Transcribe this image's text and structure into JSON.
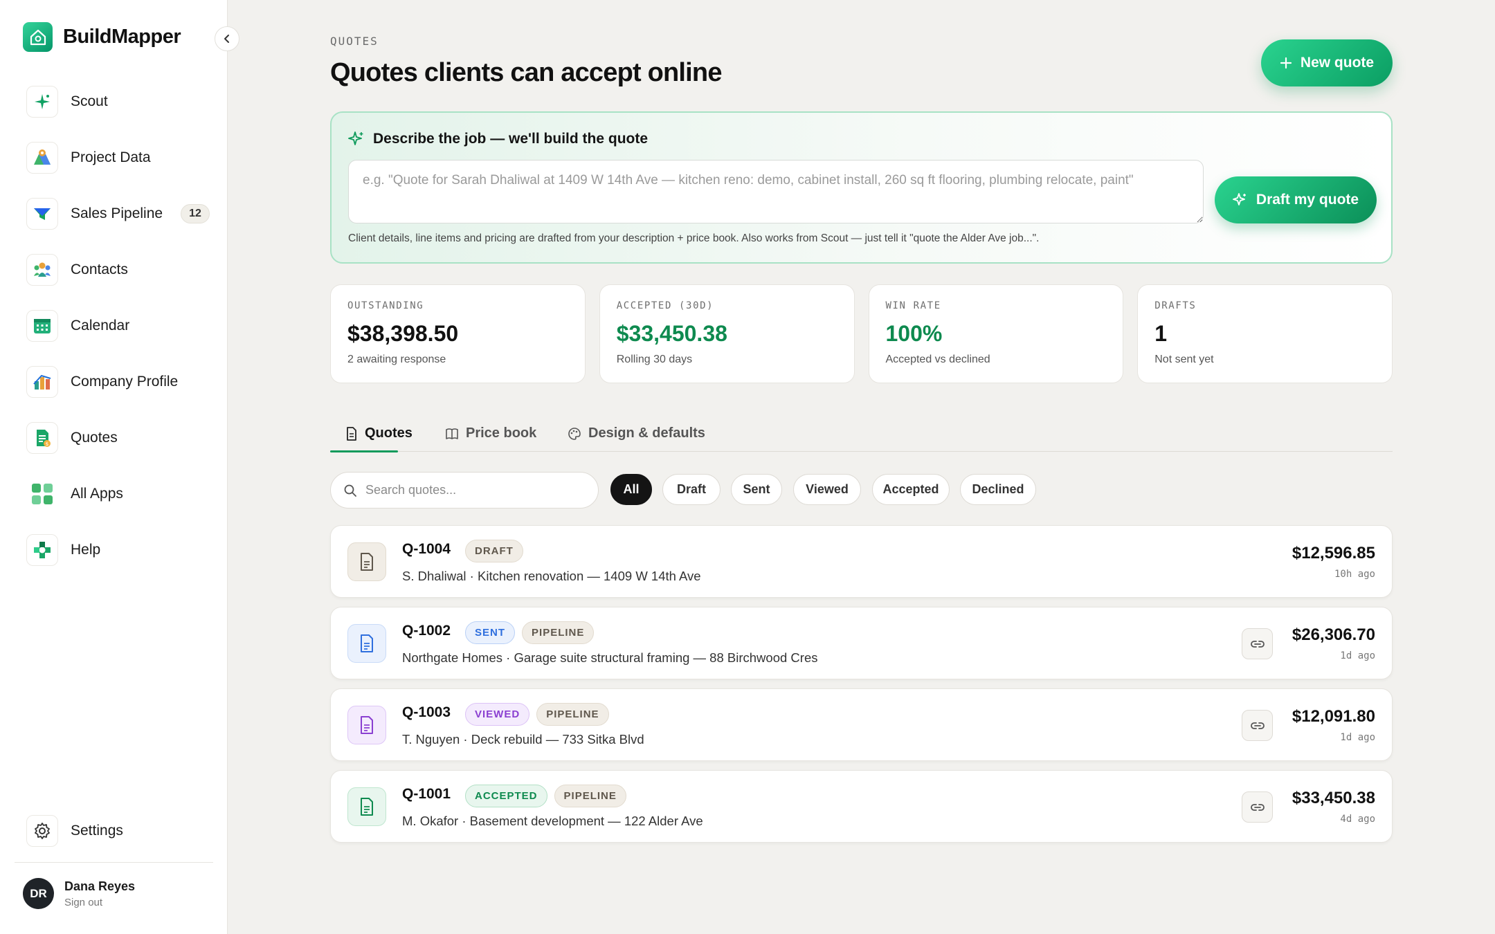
{
  "app": {
    "name": "BuildMapper"
  },
  "sidebar": {
    "items": [
      {
        "label": "Scout",
        "icon": "sparkle-icon"
      },
      {
        "label": "Project Data",
        "icon": "map-icon"
      },
      {
        "label": "Sales Pipeline",
        "icon": "funnel-icon",
        "badge": "12"
      },
      {
        "label": "Contacts",
        "icon": "people-icon"
      },
      {
        "label": "Calendar",
        "icon": "calendar-icon"
      },
      {
        "label": "Company Profile",
        "icon": "chart-icon"
      },
      {
        "label": "Quotes",
        "icon": "quote-doc-icon"
      },
      {
        "label": "All Apps",
        "icon": "grid-icon"
      },
      {
        "label": "Help",
        "icon": "help-icon"
      }
    ],
    "settings_label": "Settings",
    "user": {
      "initials": "DR",
      "name": "Dana Reyes",
      "action": "Sign out"
    }
  },
  "header": {
    "eyebrow": "QUOTES",
    "title": "Quotes clients can accept online",
    "new_quote_label": "New quote"
  },
  "ai_panel": {
    "heading": "Describe the job — we'll build the quote",
    "placeholder": "e.g. \"Quote for Sarah Dhaliwal at 1409 W 14th Ave — kitchen reno: demo, cabinet install, 260 sq ft flooring, plumbing relocate, paint\"",
    "button_label": "Draft my quote",
    "note": "Client details, line items and pricing are drafted from your description + price book. Also works from Scout — just tell it \"quote the Alder Ave job...\"."
  },
  "stats": [
    {
      "label": "OUTSTANDING",
      "value": "$38,398.50",
      "sub": "2 awaiting response"
    },
    {
      "label": "ACCEPTED (30D)",
      "value": "$33,450.38",
      "sub": "Rolling 30 days"
    },
    {
      "label": "WIN RATE",
      "value": "100%",
      "sub": "Accepted vs declined"
    },
    {
      "label": "DRAFTS",
      "value": "1",
      "sub": "Not sent yet"
    }
  ],
  "tabs": [
    {
      "label": "Quotes"
    },
    {
      "label": "Price book"
    },
    {
      "label": "Design & defaults"
    }
  ],
  "search": {
    "placeholder": "Search quotes..."
  },
  "filters": [
    "All",
    "Draft",
    "Sent",
    "Viewed",
    "Accepted",
    "Declined"
  ],
  "quotes": [
    {
      "id": "Q-1004",
      "status": "DRAFT",
      "pipeline": "",
      "client": "S. Dhaliwal",
      "description": "Kitchen renovation — 1409 W 14th Ave",
      "amount": "$12,596.85",
      "time": "10h ago"
    },
    {
      "id": "Q-1002",
      "status": "SENT",
      "pipeline": "PIPELINE",
      "client": "Northgate Homes",
      "description": "Garage suite structural framing — 88 Birchwood Cres",
      "amount": "$26,306.70",
      "time": "1d ago"
    },
    {
      "id": "Q-1003",
      "status": "VIEWED",
      "pipeline": "PIPELINE",
      "client": "T. Nguyen",
      "description": "Deck rebuild — 733 Sitka Blvd",
      "amount": "$12,091.80",
      "time": "1d ago"
    },
    {
      "id": "Q-1001",
      "status": "ACCEPTED",
      "pipeline": "PIPELINE",
      "client": "M. Okafor",
      "description": "Basement development — 122 Alder Ave",
      "amount": "$33,450.38",
      "time": "4d ago"
    }
  ],
  "colors": {
    "accent": "#0e9a5b",
    "draft": "#6b6357",
    "sent": "#2f6fde",
    "viewed": "#8a3fd1",
    "accepted": "#0e8a4f"
  }
}
